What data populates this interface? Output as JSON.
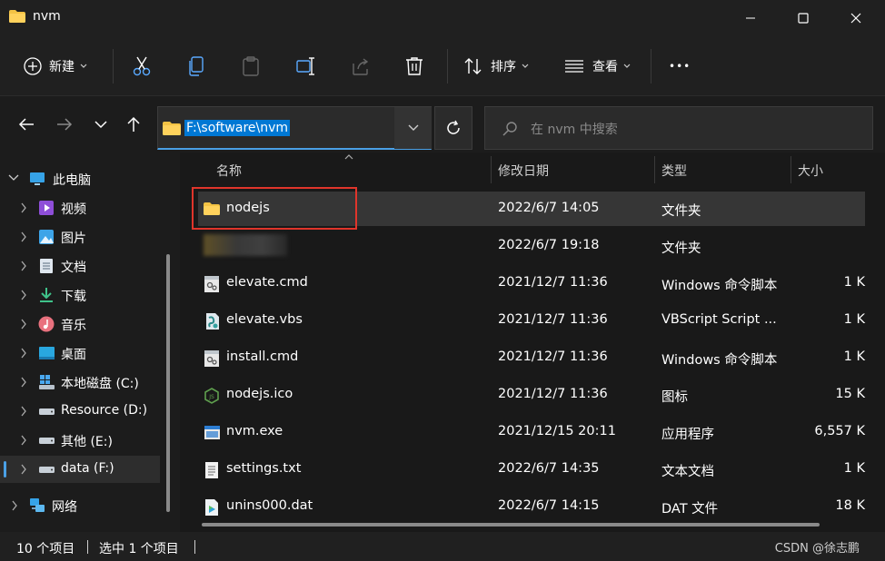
{
  "window": {
    "title": "nvm"
  },
  "toolbar": {
    "new_label": "新建",
    "sort_label": "排序",
    "view_label": "查看",
    "more_label": "•••"
  },
  "address": {
    "path": "F:\\software\\nvm",
    "search_placeholder": "在 nvm 中搜索"
  },
  "sidebar": {
    "items": [
      {
        "label": "此电脑",
        "icon": "pc-icon"
      },
      {
        "label": "视频",
        "icon": "video-icon"
      },
      {
        "label": "图片",
        "icon": "pictures-icon"
      },
      {
        "label": "文档",
        "icon": "documents-icon"
      },
      {
        "label": "下载",
        "icon": "download-icon"
      },
      {
        "label": "音乐",
        "icon": "music-icon"
      },
      {
        "label": "桌面",
        "icon": "desktop-icon"
      },
      {
        "label": "本地磁盘 (C:)",
        "icon": "drive-icon"
      },
      {
        "label": "Resource (D:)",
        "icon": "drive-icon"
      },
      {
        "label": "其他 (E:)",
        "icon": "drive-icon"
      },
      {
        "label": "data (F:)",
        "icon": "drive-icon"
      },
      {
        "label": "网络",
        "icon": "network-icon"
      }
    ]
  },
  "columns": {
    "name": "名称",
    "date": "修改日期",
    "type": "类型",
    "size": "大小"
  },
  "files": [
    {
      "name": "nodejs",
      "date": "2022/6/7 14:05",
      "type": "文件夹",
      "size": ""
    },
    {
      "name": "",
      "date": "2022/6/7 19:18",
      "type": "文件夹",
      "size": ""
    },
    {
      "name": "elevate.cmd",
      "date": "2021/12/7 11:36",
      "type": "Windows 命令脚本",
      "size": "1 K"
    },
    {
      "name": "elevate.vbs",
      "date": "2021/12/7 11:36",
      "type": "VBScript Script ...",
      "size": "1 K"
    },
    {
      "name": "install.cmd",
      "date": "2021/12/7 11:36",
      "type": "Windows 命令脚本",
      "size": "1 K"
    },
    {
      "name": "nodejs.ico",
      "date": "2021/12/7 11:36",
      "type": "图标",
      "size": "15 K"
    },
    {
      "name": "nvm.exe",
      "date": "2021/12/15 20:11",
      "type": "应用程序",
      "size": "6,557 K"
    },
    {
      "name": "settings.txt",
      "date": "2022/6/7 14:35",
      "type": "文本文档",
      "size": "1 K"
    },
    {
      "name": "unins000.dat",
      "date": "2022/6/7 14:15",
      "type": "DAT 文件",
      "size": "18 K"
    }
  ],
  "status": {
    "count": "10 个项目",
    "selected": "选中 1 个项目",
    "watermark": "CSDN @徐志鹏"
  },
  "colors": {
    "accent": "#0078d4",
    "folder": "#f4c344",
    "highlight_box": "#e0352b"
  }
}
